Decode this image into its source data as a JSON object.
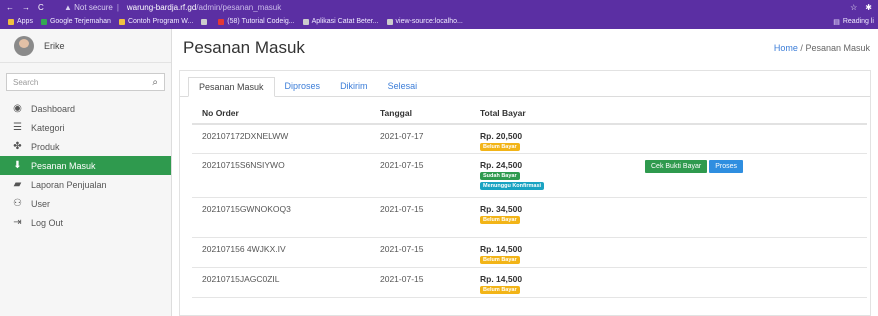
{
  "browser": {
    "not_secure": "Not secure",
    "url_domain": "warung-bardja.rf.gd",
    "url_path": "/admin/pesanan_masuk",
    "bookmarks": [
      {
        "label": "Apps",
        "color": "#f0c040"
      },
      {
        "label": "Google Terjemahan",
        "color": "#34a853"
      },
      {
        "label": "Contoh Program W...",
        "color": "#f0c040"
      },
      {
        "label": "",
        "color": "#cccccc"
      },
      {
        "label": "(58) Tutorial Codeig...",
        "color": "#e53935"
      },
      {
        "label": "Aplikasi Catat Beter...",
        "color": "#cccccc"
      },
      {
        "label": "view-source:localho...",
        "color": "#cccccc"
      }
    ],
    "reading_list": "Reading li"
  },
  "sidebar": {
    "username": "Erike",
    "search_placeholder": "Search",
    "items": [
      {
        "label": "Dashboard",
        "icon": "dashboard-icon",
        "glyph": "◉"
      },
      {
        "label": "Kategori",
        "icon": "list-icon",
        "glyph": "☰"
      },
      {
        "label": "Produk",
        "icon": "product-icon",
        "glyph": "✤"
      },
      {
        "label": "Pesanan Masuk",
        "icon": "download-icon",
        "glyph": "⬇",
        "active": true
      },
      {
        "label": "Laporan Penjualan",
        "icon": "report-icon",
        "glyph": "▰"
      },
      {
        "label": "User",
        "icon": "users-icon",
        "glyph": "⚇"
      },
      {
        "label": "Log Out",
        "icon": "logout-icon",
        "glyph": "⇥"
      }
    ]
  },
  "page": {
    "title": "Pesanan Masuk",
    "breadcrumb_home": "Home",
    "breadcrumb_sep": "/",
    "breadcrumb_current": "Pesanan Masuk"
  },
  "tabs": [
    "Pesanan Masuk",
    "Diproses",
    "Dikirim",
    "Selesai"
  ],
  "table": {
    "headers": [
      "No Order",
      "Tanggal",
      "Total Bayar"
    ],
    "rows": [
      {
        "order": "202107172DXNELWW",
        "date": "2021-07-17",
        "total": "Rp. 20,500",
        "badges": [
          {
            "text": "Belum Bayar",
            "type": "warning"
          }
        ],
        "buttons": []
      },
      {
        "order": "20210715S6NSIYWO",
        "date": "2021-07-15",
        "total": "Rp. 24,500",
        "badges": [
          {
            "text": "Sudah Bayar",
            "type": "success"
          },
          {
            "text": "Menunggu Konfirmasi",
            "type": "info"
          }
        ],
        "buttons": [
          {
            "text": "Cek Bukti Bayar",
            "type": "green"
          },
          {
            "text": "Proses",
            "type": "blue"
          }
        ]
      },
      {
        "order": "20210715GWNOKOQ3",
        "date": "2021-07-15",
        "total": "Rp. 34,500",
        "badges": [
          {
            "text": "Belum Bayar",
            "type": "warning"
          }
        ],
        "buttons": []
      },
      {
        "order": "202107156 4WJKX.IV",
        "date": "2021-07-15",
        "total": "Rp. 14,500",
        "badges": [
          {
            "text": "Belum Bayar",
            "type": "warning"
          }
        ],
        "buttons": []
      },
      {
        "order": "20210715JAGC0ZIL",
        "date": "2021-07-15",
        "total": "Rp. 14,500",
        "badges": [
          {
            "text": "Belum Bayar",
            "type": "warning"
          }
        ],
        "buttons": []
      }
    ]
  }
}
